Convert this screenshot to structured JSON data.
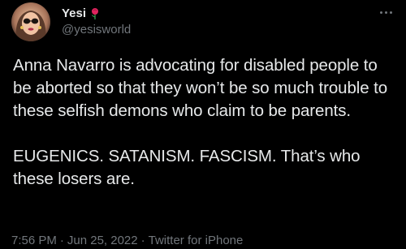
{
  "tweet": {
    "display_name": "Yesi",
    "handle": "@yesisworld",
    "paragraphs": [
      "Anna Navarro is advocating for disabled people to be aborted so that they won’t be so much trouble to these selfish demons who claim to be parents.",
      "EUGENICS. SATANISM. FASCISM. That’s who these losers are."
    ],
    "time": "7:56 PM",
    "separator": "·",
    "date": "Jun 25, 2022",
    "client": "Twitter for iPhone"
  },
  "icons": {
    "name_emoji": "rose-icon",
    "menu": "more-icon"
  },
  "colors": {
    "background": "#000000",
    "primary_text": "#e7e9ea",
    "secondary_text": "#71767b",
    "rose": "#e0245e"
  }
}
